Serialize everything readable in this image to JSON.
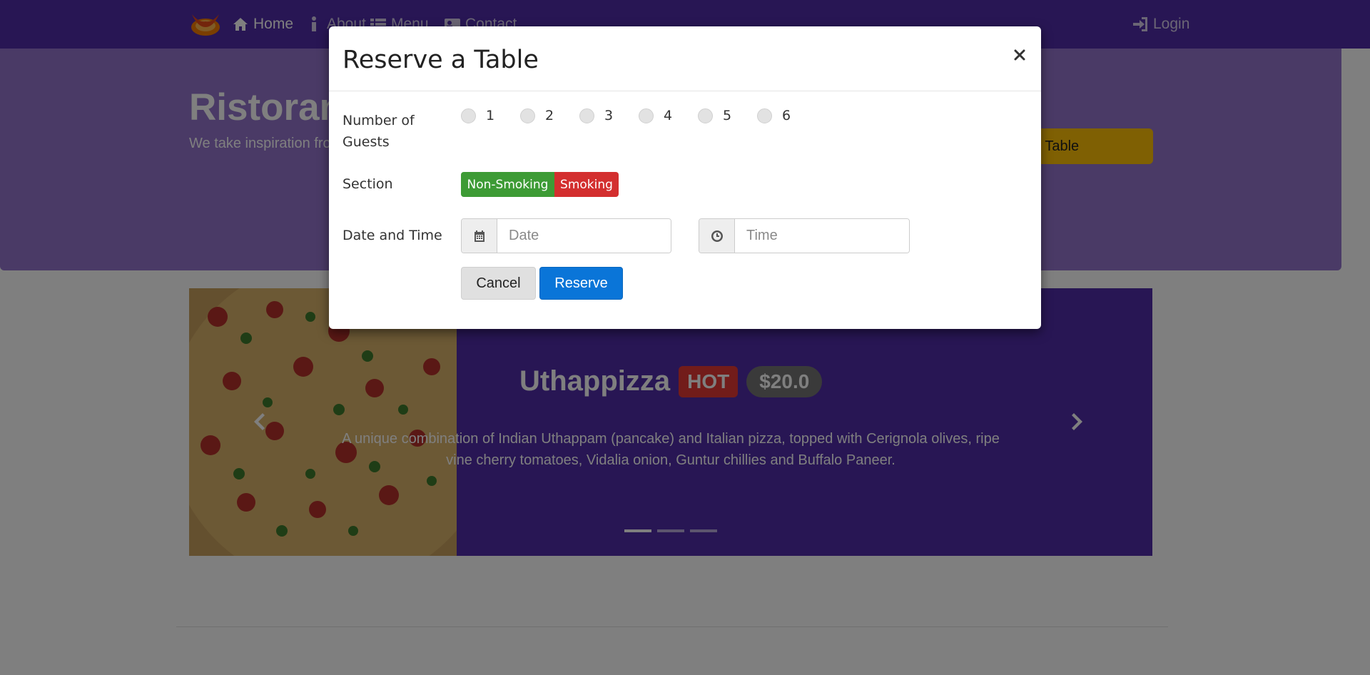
{
  "navbar": {
    "items": [
      {
        "label": "Home",
        "icon": "home-icon"
      },
      {
        "label": "About",
        "icon": "info-icon"
      },
      {
        "label": "Menu",
        "icon": "list-icon"
      },
      {
        "label": "Contact",
        "icon": "address-card-icon"
      }
    ],
    "login_label": "Login",
    "colors": {
      "background": "#512DA8"
    }
  },
  "jumbotron": {
    "title": "Ristorante",
    "text": "We take inspiration fro fusion experience. Our senses!",
    "button_label": "e Table"
  },
  "carousel": {
    "dish_name": "Uthappizza",
    "badge_label": "HOT",
    "price": "$20.0",
    "description": "A unique combination of Indian Uthappam (pancake) and Italian pizza, topped with Cerignola olives, ripe vine cherry tomatoes, Vidalia onion, Guntur chillies and Buffalo Paneer.",
    "indicator_count": 3,
    "active_indicator": 0
  },
  "modal": {
    "title": "Reserve a Table",
    "close_symbol": "×",
    "guests_label": "Number of Guests",
    "guest_options": [
      "1",
      "2",
      "3",
      "4",
      "5",
      "6"
    ],
    "section_label": "Section",
    "section_options": [
      "Non-Smoking",
      "Smoking"
    ],
    "datetime_label": "Date and Time",
    "date_placeholder": "Date",
    "time_placeholder": "Time",
    "cancel_label": "Cancel",
    "reserve_label": "Reserve",
    "colors": {
      "non_smoking": "#3d9b35",
      "smoking": "#d32f2f",
      "reserve": "#0a75d8"
    }
  }
}
